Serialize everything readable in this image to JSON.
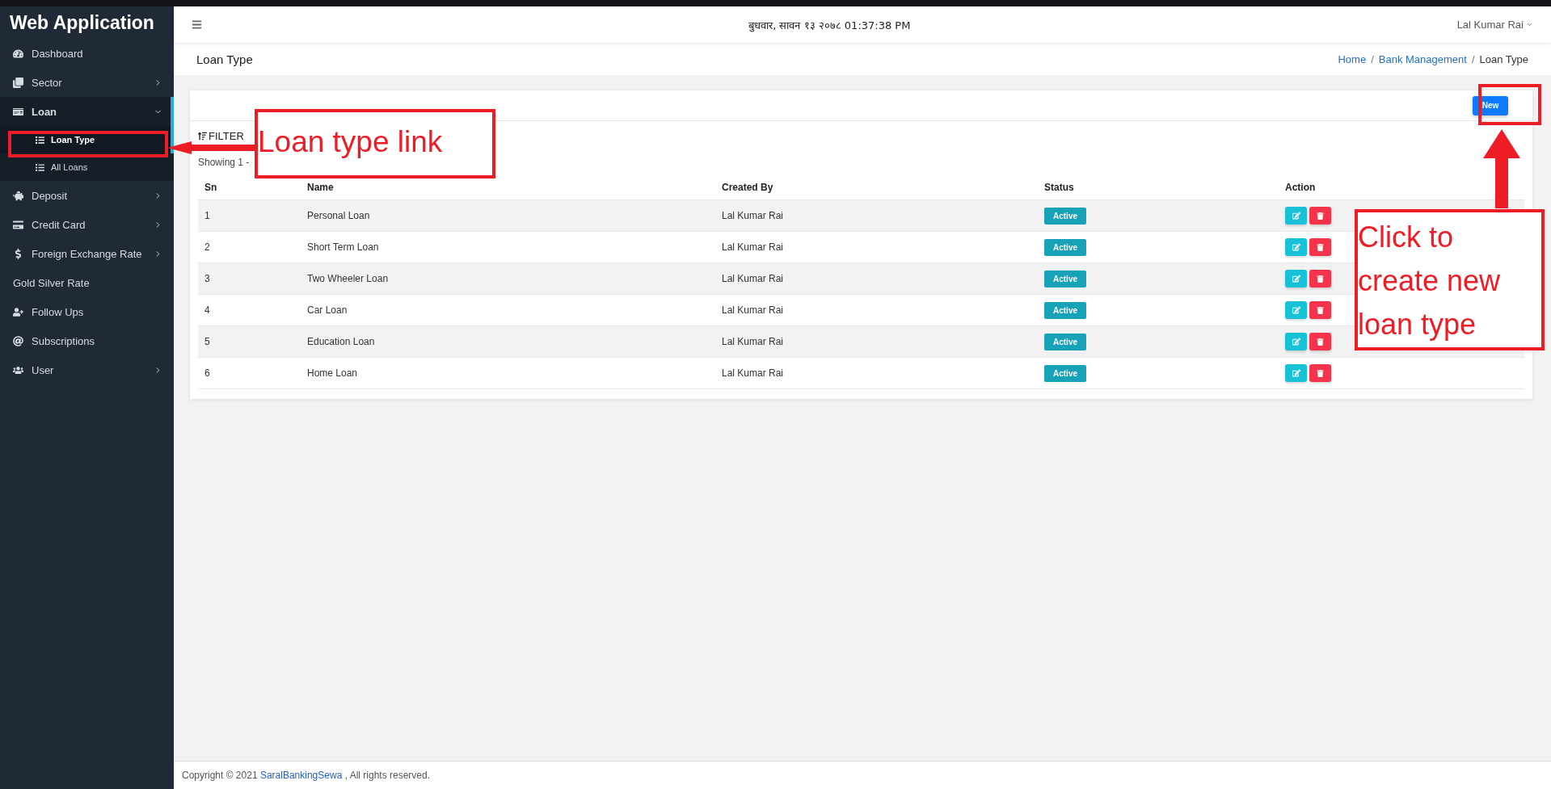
{
  "sidebar": {
    "title": "Web Application",
    "items": [
      {
        "label": "Dashboard",
        "expandable": false,
        "expanded": false,
        "selected": false
      },
      {
        "label": "Sector",
        "expandable": true,
        "expanded": false,
        "selected": false
      },
      {
        "label": "Loan",
        "expandable": true,
        "expanded": true,
        "selected": false,
        "children": [
          {
            "label": "Loan Type",
            "selected": true
          },
          {
            "label": "All Loans",
            "selected": false
          }
        ]
      },
      {
        "label": "Deposit",
        "expandable": true,
        "expanded": false,
        "selected": false
      },
      {
        "label": "Credit Card",
        "expandable": true,
        "expanded": false,
        "selected": false
      },
      {
        "label": "Foreign Exchange Rate",
        "expandable": true,
        "expanded": false,
        "selected": false
      },
      {
        "label": "Gold Silver Rate",
        "expandable": false,
        "expanded": false,
        "selected": false
      },
      {
        "label": "Follow Ups",
        "expandable": false,
        "expanded": false,
        "selected": false
      },
      {
        "label": "Subscriptions",
        "expandable": false,
        "expanded": false,
        "selected": false
      },
      {
        "label": "User",
        "expandable": true,
        "expanded": false,
        "selected": false
      }
    ]
  },
  "header": {
    "datetime": "बुधवार, सावन १३ २०७८ 01:37:38 PM",
    "user": "Lal Kumar Rai"
  },
  "page_title": "Loan Type",
  "breadcrumb": [
    {
      "label": "Home",
      "link": true
    },
    {
      "separator": "/",
      "label": "Bank Management",
      "link": true
    },
    {
      "separator": "/",
      "label": "Loan Type",
      "link": false
    }
  ],
  "card": {
    "new_button": "New",
    "filter": "FILTER",
    "showing": "Showing 1 -"
  },
  "table": {
    "columns": [
      "Sn",
      "Name",
      "Created By",
      "Status",
      "Action"
    ],
    "rows": [
      {
        "sn": "1",
        "name": "Personal Loan",
        "created_by": "Lal Kumar Rai",
        "status": "Active"
      },
      {
        "sn": "2",
        "name": "Short Term Loan",
        "created_by": "Lal Kumar Rai",
        "status": "Active"
      },
      {
        "sn": "3",
        "name": "Two Wheeler Loan",
        "created_by": "Lal Kumar Rai",
        "status": "Active"
      },
      {
        "sn": "4",
        "name": "Car Loan",
        "created_by": "Lal Kumar Rai",
        "status": "Active"
      },
      {
        "sn": "5",
        "name": "Education Loan",
        "created_by": "Lal Kumar Rai",
        "status": "Active"
      },
      {
        "sn": "6",
        "name": "Home Loan",
        "created_by": "Lal Kumar Rai",
        "status": "Active"
      }
    ]
  },
  "footer": {
    "before": "Copyright © 2021 ",
    "link": "SaralBankingSewa",
    "after": " , All rights reserved."
  },
  "annotations": [
    {
      "kind": "callout",
      "text": "Loan type link"
    },
    {
      "kind": "callout",
      "text": "Click to create new loan type"
    }
  ]
}
